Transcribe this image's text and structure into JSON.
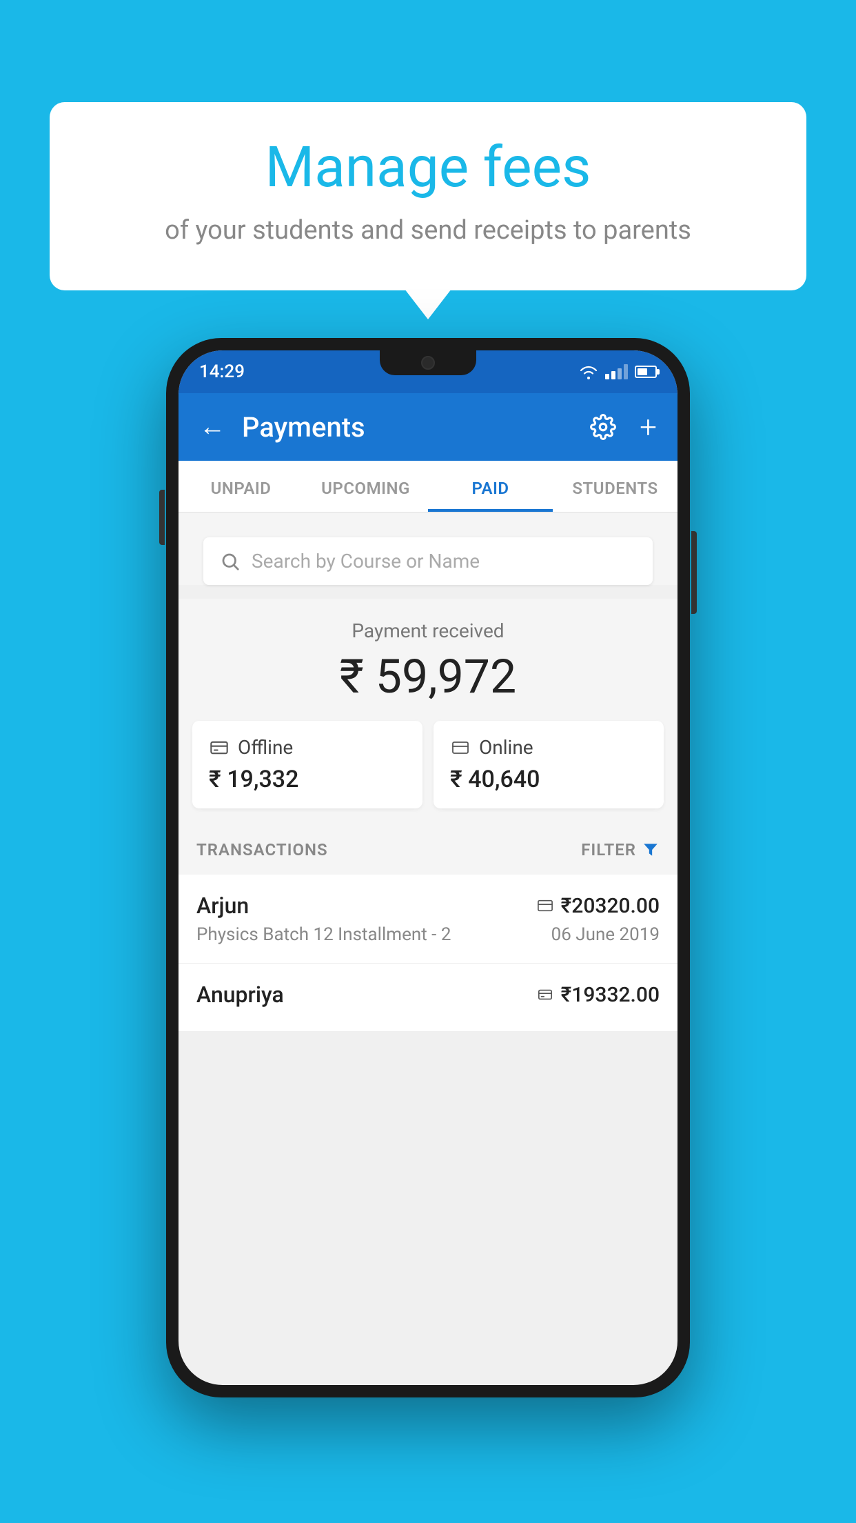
{
  "background_color": "#1ab8e8",
  "bubble": {
    "title": "Manage fees",
    "subtitle": "of your students and send receipts to parents"
  },
  "phone": {
    "status_bar": {
      "time": "14:29"
    },
    "app_bar": {
      "title": "Payments",
      "back_label": "←",
      "plus_label": "+"
    },
    "tabs": [
      {
        "label": "UNPAID",
        "active": false
      },
      {
        "label": "UPCOMING",
        "active": false
      },
      {
        "label": "PAID",
        "active": true
      },
      {
        "label": "STUDENTS",
        "active": false
      }
    ],
    "search": {
      "placeholder": "Search by Course or Name"
    },
    "payment_summary": {
      "label": "Payment received",
      "amount": "₹ 59,972"
    },
    "cards": [
      {
        "type": "Offline",
        "amount": "₹ 19,332",
        "icon": "💳"
      },
      {
        "type": "Online",
        "amount": "₹ 40,640",
        "icon": "💳"
      }
    ],
    "transactions_label": "TRANSACTIONS",
    "filter_label": "FILTER",
    "transactions": [
      {
        "name": "Arjun",
        "detail": "Physics Batch 12 Installment - 2",
        "amount": "₹20320.00",
        "date": "06 June 2019",
        "payment_type": "online"
      },
      {
        "name": "Anupriya",
        "detail": "",
        "amount": "₹19332.00",
        "date": "",
        "payment_type": "offline"
      }
    ]
  }
}
